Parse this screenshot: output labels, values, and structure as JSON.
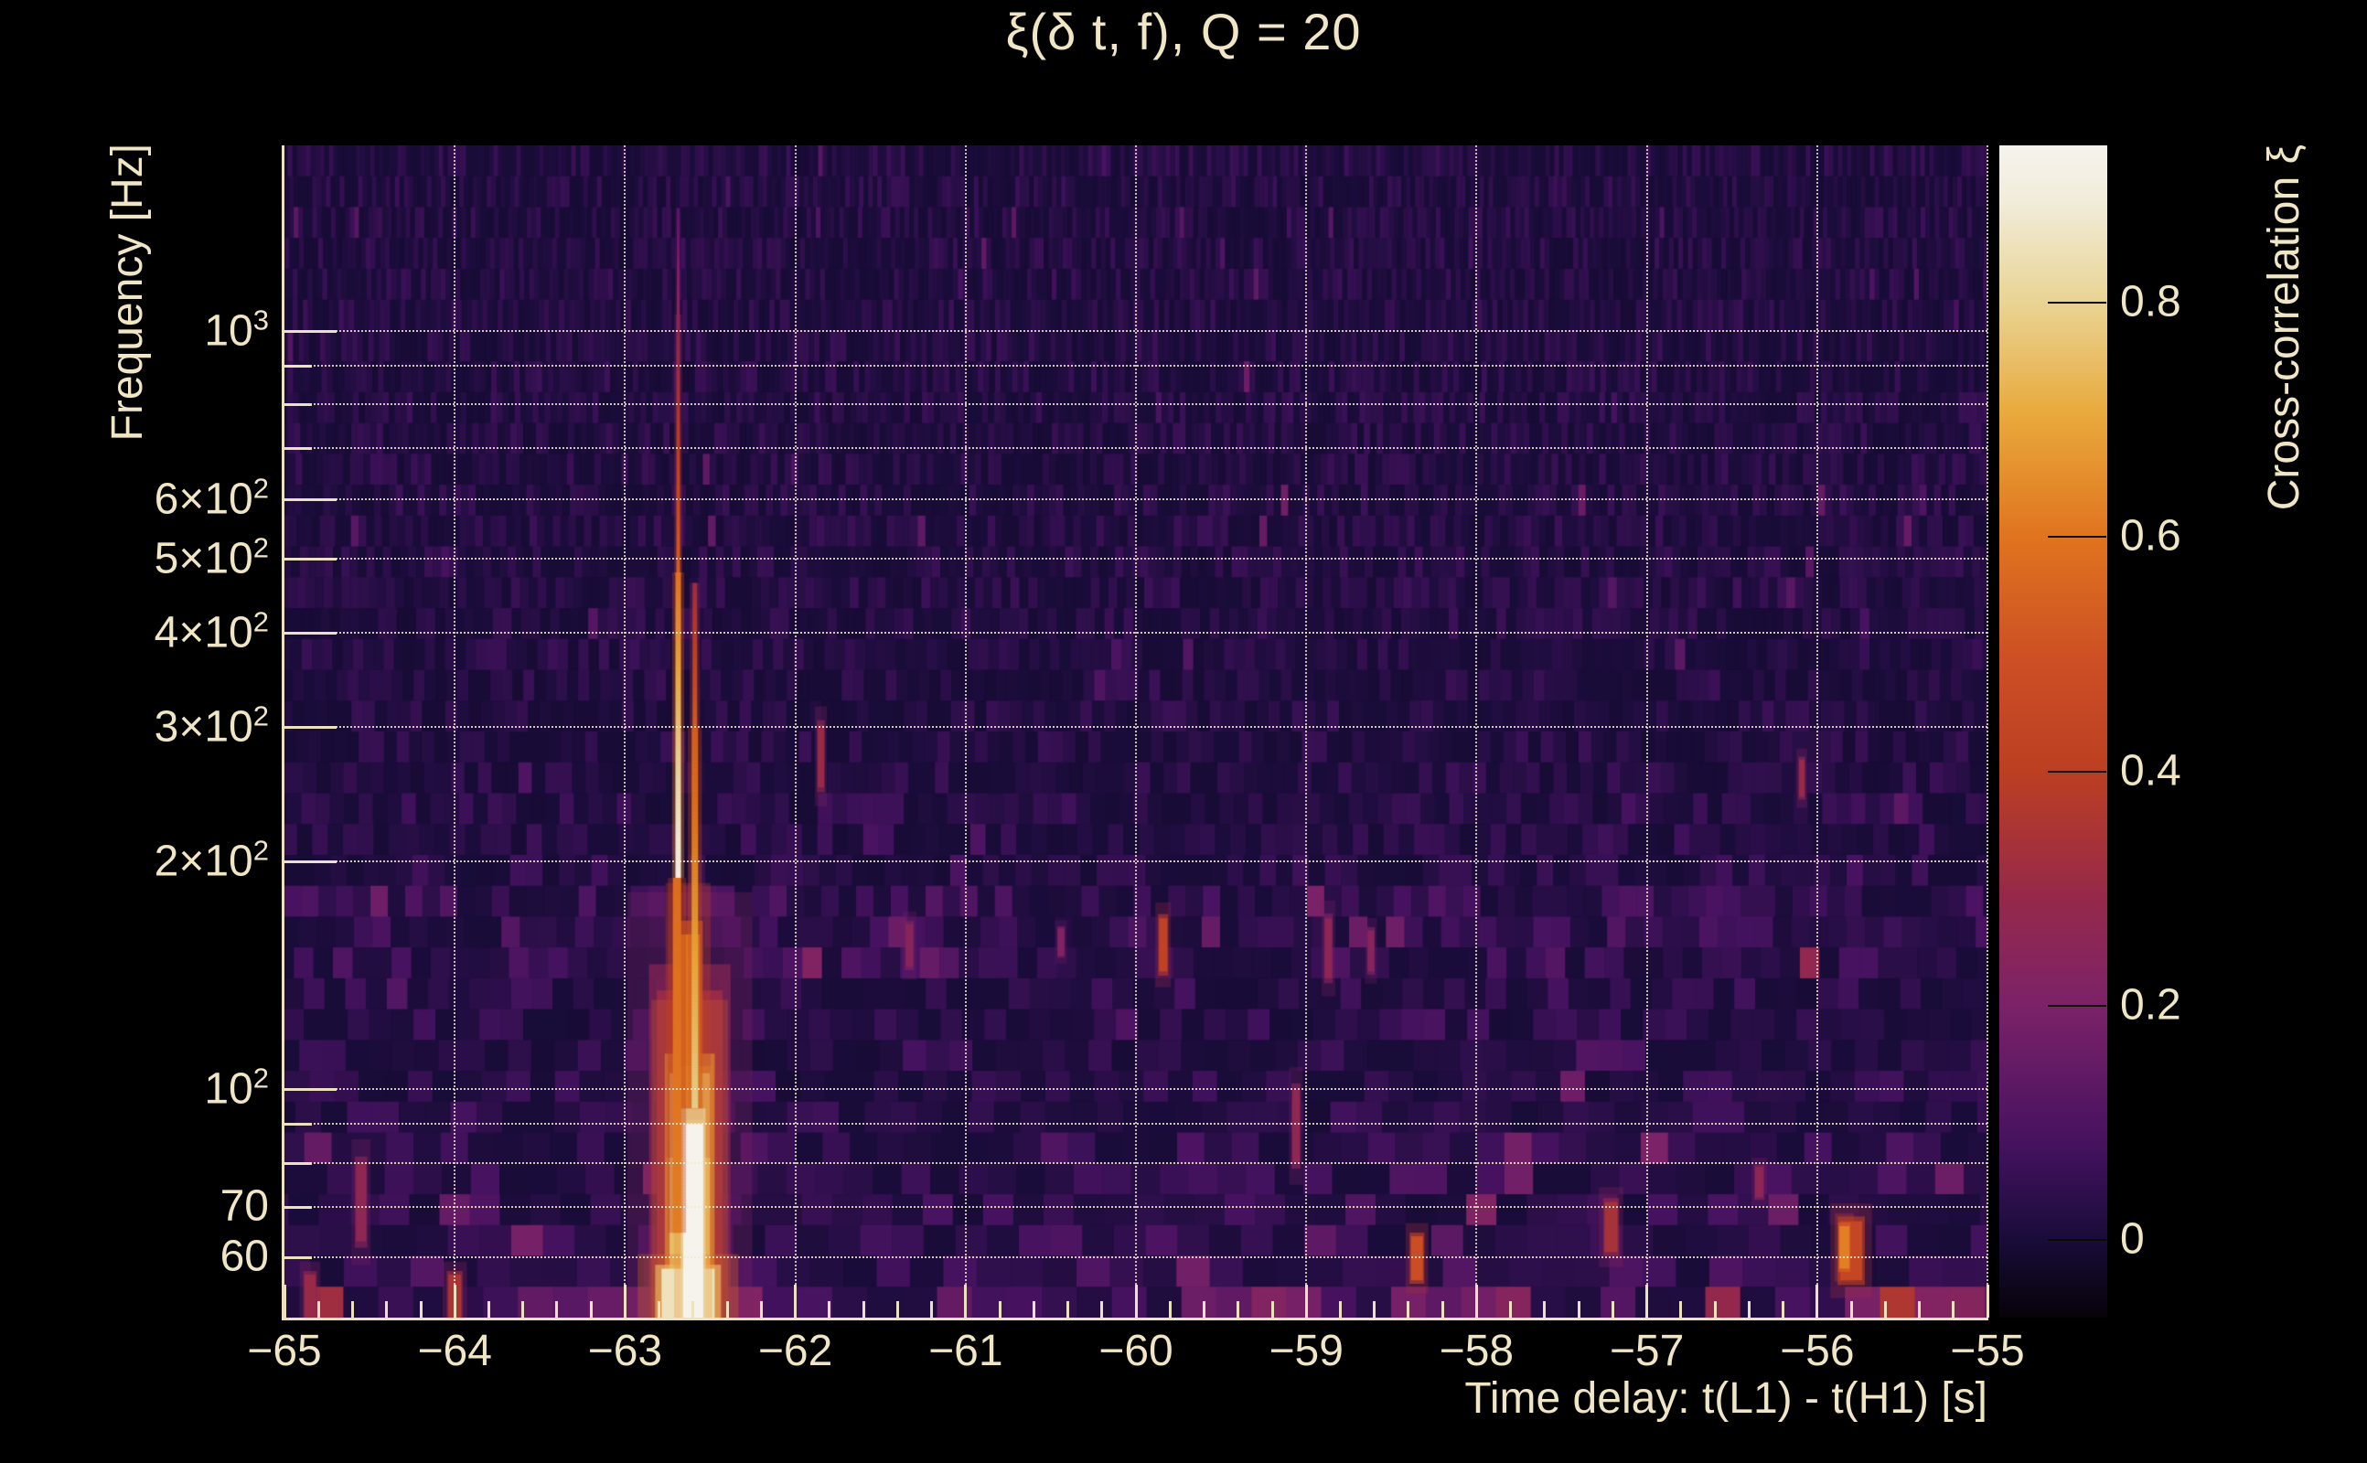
{
  "chart_data": {
    "type": "heatmap",
    "title": "ξ(δ t, f), Q = 20",
    "xlabel": "Time delay: t(L1) - t(H1) [s]",
    "ylabel": "Frequency [Hz]",
    "x_range": [
      -65,
      -55
    ],
    "y_range_hz": [
      50,
      1755
    ],
    "y_scale": "log",
    "grid": true,
    "x_ticks": [
      {
        "t": -65,
        "label": "−65"
      },
      {
        "t": -64,
        "label": "−64"
      },
      {
        "t": -63,
        "label": "−63"
      },
      {
        "t": -62,
        "label": "−62"
      },
      {
        "t": -61,
        "label": "−61"
      },
      {
        "t": -60,
        "label": "−60"
      },
      {
        "t": -59,
        "label": "−59"
      },
      {
        "t": -58,
        "label": "−58"
      },
      {
        "t": -57,
        "label": "−57"
      },
      {
        "t": -56,
        "label": "−56"
      },
      {
        "t": -55,
        "label": "−55"
      }
    ],
    "x_minor_step": 0.2,
    "x_gridlines": [
      -64,
      -63,
      -62,
      -61,
      -60,
      -59,
      -58,
      -57,
      -56,
      -55
    ],
    "y_ticks": [
      {
        "f": 1000,
        "base": "10",
        "sup": "3",
        "major": true
      },
      {
        "f": 900,
        "base": "",
        "sup": "",
        "major": false
      },
      {
        "f": 800,
        "base": "",
        "sup": "",
        "major": false
      },
      {
        "f": 700,
        "base": "",
        "sup": "",
        "major": false
      },
      {
        "f": 600,
        "base": "6×10",
        "sup": "2",
        "major": true
      },
      {
        "f": 500,
        "base": "5×10",
        "sup": "2",
        "major": true
      },
      {
        "f": 400,
        "base": "4×10",
        "sup": "2",
        "major": true
      },
      {
        "f": 300,
        "base": "3×10",
        "sup": "2",
        "major": true
      },
      {
        "f": 200,
        "base": "2×10",
        "sup": "2",
        "major": true
      },
      {
        "f": 100,
        "base": "10",
        "sup": "2",
        "major": true
      },
      {
        "f": 90,
        "base": "",
        "sup": "",
        "major": false
      },
      {
        "f": 80,
        "base": "",
        "sup": "",
        "major": false
      },
      {
        "f": 70,
        "base": "70",
        "sup": "",
        "major": false
      },
      {
        "f": 60,
        "base": "60",
        "sup": "",
        "major": false
      }
    ],
    "colorbar": {
      "label": "Cross-correlation ξ",
      "value_range": [
        -0.066,
        0.934
      ],
      "ticks": [
        {
          "v": 0.8,
          "label": "0.8"
        },
        {
          "v": 0.6,
          "label": "0.6"
        },
        {
          "v": 0.4,
          "label": "0.4"
        },
        {
          "v": 0.2,
          "label": "0.2"
        },
        {
          "v": 0,
          "label": "0"
        }
      ],
      "stops": [
        {
          "pos": 0.0,
          "color": "#f6f3ee"
        },
        {
          "pos": 0.05,
          "color": "#f1ecd8"
        },
        {
          "pos": 0.1334,
          "color": "#e9d494"
        },
        {
          "pos": 0.23,
          "color": "#e9a93c"
        },
        {
          "pos": 0.3334,
          "color": "#e0741f"
        },
        {
          "pos": 0.44,
          "color": "#cc4f25"
        },
        {
          "pos": 0.5335,
          "color": "#bc3f22"
        },
        {
          "pos": 0.64,
          "color": "#96294a"
        },
        {
          "pos": 0.7333,
          "color": "#7c2268"
        },
        {
          "pos": 0.85,
          "color": "#461260"
        },
        {
          "pos": 0.9337,
          "color": "#190c39"
        },
        {
          "pos": 1.0,
          "color": "#060309"
        }
      ]
    },
    "noise": {
      "seed": 12,
      "rows": 38,
      "col_width_range": [
        5,
        40
      ],
      "base_value": 0.04,
      "default_spike_p": 0.013,
      "default_spike_v": 0.09,
      "bands": [
        {
          "f1": 185,
          "f2": 235,
          "base": 0.045,
          "spike_p": 0.02,
          "spike_v": 0.08
        },
        {
          "f1": 135,
          "f2": 185,
          "base": 0.065,
          "spike_p": 0.05,
          "spike_v": 0.14
        },
        {
          "f1": 85,
          "f2": 135,
          "base": 0.05,
          "spike_p": 0.025,
          "spike_v": 0.1
        },
        {
          "f1": 57,
          "f2": 85,
          "base": 0.065,
          "spike_p": 0.05,
          "spike_v": 0.13
        },
        {
          "f1": 49,
          "f2": 57,
          "base": 0.11,
          "spike_p": 0.22,
          "spike_v": 0.16
        }
      ]
    },
    "features": [
      {
        "name": "event-halo-base",
        "type": "blob",
        "t": -62.62,
        "f1": 50,
        "f2": 135,
        "w": 72,
        "v": 0.3
      },
      {
        "name": "event-base-broad",
        "type": "blob",
        "t": -62.62,
        "f1": 50,
        "f2": 105,
        "w": 44,
        "v": 0.75
      },
      {
        "name": "event-base-mid",
        "type": "blob",
        "t": -62.63,
        "f1": 95,
        "f2": 160,
        "w": 26,
        "v": 0.6
      },
      {
        "name": "event-base-flare",
        "type": "blob",
        "t": -62.63,
        "f1": 50,
        "f2": 58,
        "w": 58,
        "v": 0.85
      },
      {
        "name": "event-base-core-white",
        "type": "blob",
        "t": -62.6,
        "f1": 50,
        "f2": 90,
        "w": 22,
        "v": 0.93
      },
      {
        "name": "event-line-top-faint",
        "type": "line",
        "t": -62.688,
        "f1": 1050,
        "f2": 1450,
        "w": 3,
        "v1": 0.25,
        "v2": 0.12
      },
      {
        "name": "event-line-upper",
        "type": "line",
        "t": -62.688,
        "f1": 480,
        "f2": 1050,
        "w": 4,
        "v1": 0.55,
        "v2": 0.25
      },
      {
        "name": "event-line-core",
        "type": "line",
        "t": -62.688,
        "f1": 190,
        "f2": 480,
        "w": 6,
        "v1": 0.93,
        "v2": 0.6
      },
      {
        "name": "event-line-left-flank",
        "type": "line",
        "t": -62.695,
        "f1": 65,
        "f2": 190,
        "w": 9,
        "v1": 0.62,
        "v2": 0.58
      },
      {
        "name": "event-line2-upper",
        "type": "line",
        "t": -62.59,
        "f1": 300,
        "f2": 465,
        "w": 5,
        "v1": 0.55,
        "v2": 0.32
      },
      {
        "name": "event-line2-lower",
        "type": "line",
        "t": -62.59,
        "f1": 95,
        "f2": 300,
        "w": 7,
        "v1": 0.8,
        "v2": 0.55
      },
      {
        "name": "glitch-250hz",
        "type": "blob",
        "t": -61.85,
        "f1": 250,
        "f2": 302,
        "w": 7,
        "v": 0.3
      },
      {
        "name": "glitch-150hz-orange",
        "type": "blob",
        "t": -59.84,
        "f1": 143,
        "f2": 168,
        "w": 9,
        "v": 0.42
      },
      {
        "name": "glitch-60hz-orange-1",
        "type": "blob",
        "t": -58.35,
        "f1": 56,
        "f2": 64,
        "w": 13,
        "v": 0.48
      },
      {
        "name": "glitch-65hz-red",
        "type": "blob",
        "t": -57.21,
        "f1": 61,
        "f2": 71,
        "w": 14,
        "v": 0.34
      },
      {
        "name": "glitch-60hz-orange-2",
        "type": "blob",
        "t": -55.8,
        "f1": 56,
        "f2": 67,
        "w": 24,
        "v": 0.45
      },
      {
        "name": "glitch-60hz-orange-2c",
        "type": "blob",
        "t": -55.84,
        "f1": 58,
        "f2": 66,
        "w": 11,
        "v": 0.62
      },
      {
        "name": "glitch-90hz-magenta",
        "type": "blob",
        "t": -59.06,
        "f1": 80,
        "f2": 100,
        "w": 8,
        "v": 0.27
      },
      {
        "name": "glitch-260hz-crimson",
        "type": "blob",
        "t": -56.09,
        "f1": 243,
        "f2": 272,
        "w": 6,
        "v": 0.3
      },
      {
        "name": "glitch-75hz-magenta",
        "type": "blob",
        "t": -56.34,
        "f1": 72,
        "f2": 79,
        "w": 9,
        "v": 0.26
      },
      {
        "name": "glitch-155hz-magenta-1",
        "type": "blob",
        "t": -61.33,
        "f1": 145,
        "f2": 165,
        "w": 8,
        "v": 0.24
      },
      {
        "name": "glitch-155hz-magenta-2",
        "type": "blob",
        "t": -60.44,
        "f1": 150,
        "f2": 163,
        "w": 7,
        "v": 0.22
      },
      {
        "name": "glitch-155hz-magenta-3",
        "type": "blob",
        "t": -58.87,
        "f1": 140,
        "f2": 168,
        "w": 8,
        "v": 0.26
      },
      {
        "name": "glitch-155hz-magenta-4",
        "type": "blob",
        "t": -58.62,
        "f1": 143,
        "f2": 162,
        "w": 7,
        "v": 0.24
      },
      {
        "name": "glitch-70hz-magenta",
        "type": "blob",
        "t": -64.55,
        "f1": 63,
        "f2": 80,
        "w": 11,
        "v": 0.27
      },
      {
        "name": "glitch-bottom-clump-1",
        "type": "blob",
        "t": -64.0,
        "f1": 50,
        "f2": 57,
        "w": 14,
        "v": 0.35
      },
      {
        "name": "glitch-bottom-clump-2",
        "type": "blob",
        "t": -64.85,
        "f1": 50,
        "f2": 57,
        "w": 12,
        "v": 0.3
      }
    ],
    "colors": {
      "background": "#000000",
      "text_cream": "#f0e6c5",
      "spine_cream": "#ece2c0",
      "gridline": "rgba(243,234,208,0.85)",
      "plot_base_purple": "#1d0d36"
    }
  }
}
